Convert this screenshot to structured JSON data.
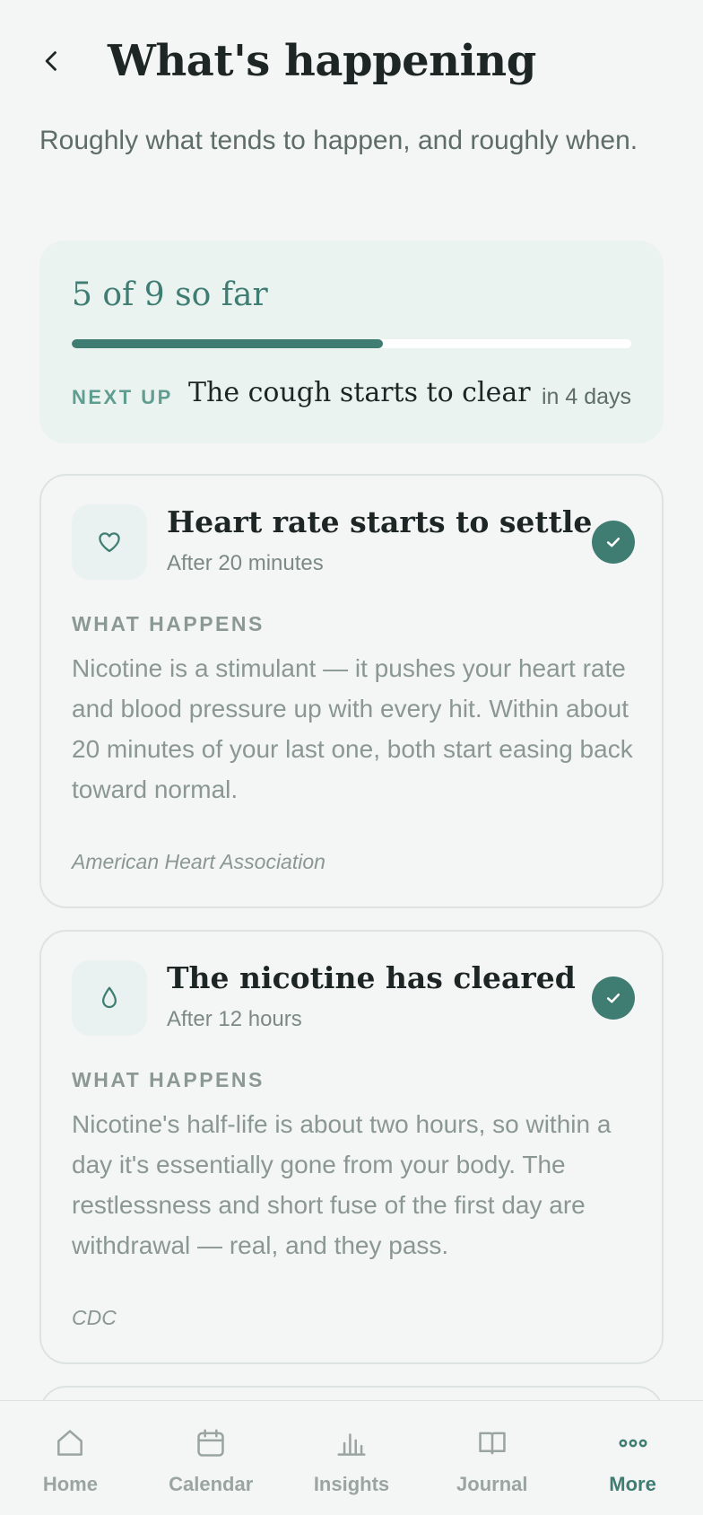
{
  "header": {
    "title": "What's happening",
    "subtitle": "Roughly what tends to happen, and roughly when."
  },
  "progress": {
    "count_text": "5 of 9 so far",
    "completed": 5,
    "total": 9,
    "next_label": "NEXT UP",
    "next_title": "The cough starts to clear",
    "next_when": "in 4 days"
  },
  "milestones": [
    {
      "icon": "heart-icon",
      "title": "Heart rate starts to settle",
      "time": "After 20 minutes",
      "section_label": "WHAT HAPPENS",
      "body": "Nicotine is a stimulant — it pushes your heart rate and blood pressure up with every hit. Within about 20 minutes of your last one, both start easing back toward normal.",
      "source": "American Heart Association",
      "completed": true
    },
    {
      "icon": "droplet-icon",
      "title": "The nicotine has cleared",
      "time": "After 12 hours",
      "section_label": "WHAT HAPPENS",
      "body": "Nicotine's half-life is about two hours, so within a day it's essentially gone from your body. The restlessness and short fuse of the first day are withdrawal — real, and they pass.",
      "source": "CDC",
      "completed": true
    }
  ],
  "tabs": [
    {
      "label": "Home",
      "icon": "home-icon",
      "active": false
    },
    {
      "label": "Calendar",
      "icon": "calendar-icon",
      "active": false
    },
    {
      "label": "Insights",
      "icon": "bar-chart-icon",
      "active": false
    },
    {
      "label": "Journal",
      "icon": "book-icon",
      "active": false
    },
    {
      "label": "More",
      "icon": "more-dots-icon",
      "active": true
    }
  ],
  "colors": {
    "accent": "#3f7d73",
    "background": "#f4f6f5",
    "progress_card_bg": "#eaf3f0"
  }
}
